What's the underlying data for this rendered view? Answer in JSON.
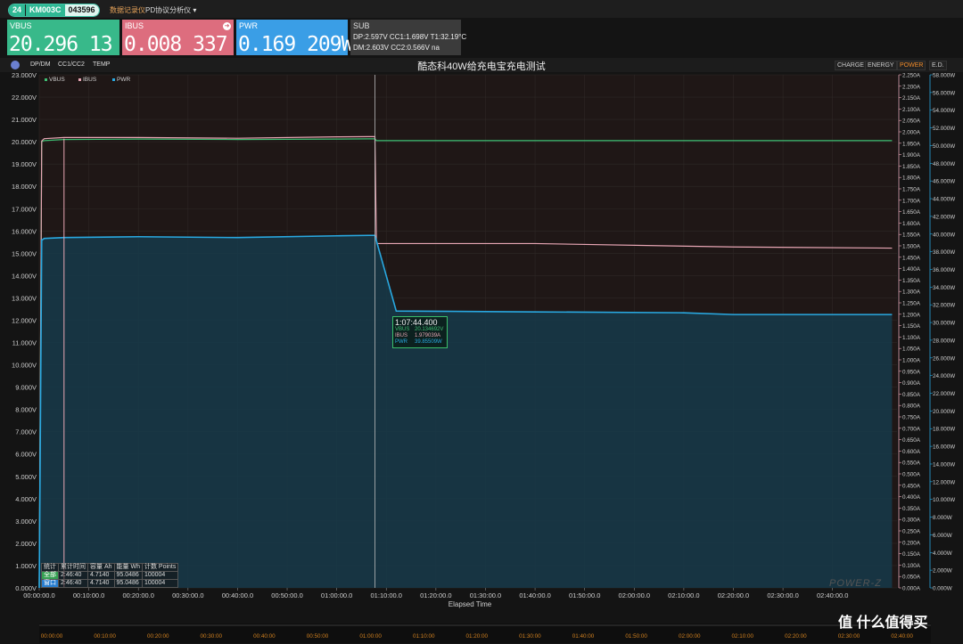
{
  "topbar": {
    "device_num": "24",
    "device_model": "KM003C",
    "device_serial": "043596",
    "menu_record": "数据记录仪",
    "menu_pd": "PD协议分析仪 ▾"
  },
  "meters": {
    "vbus": {
      "label": "VBUS",
      "value": "20.296 13 V"
    },
    "ibus": {
      "label": "IBUS",
      "value": "0.008 337 A"
    },
    "pwr": {
      "label": "PWR",
      "value": "0.169 209W"
    },
    "sub": {
      "label": "SUB",
      "row1": "DP:2.597V   CC1:1.698V   T1:32.19°C",
      "row2": "DM:2.603V   CC2:0.566V  na"
    }
  },
  "chart_header": {
    "tabs": [
      "DP/DM",
      "CC1/CC2",
      "TEMP"
    ],
    "title": "酷态科40W给充电宝充电测试",
    "right_tabs": [
      "CHARGE",
      "ENERGY",
      "POWER",
      "E.D."
    ],
    "active_right_tab": "POWER"
  },
  "tooltip": {
    "time": "1:07:44.400",
    "vbus_label": "VBUS",
    "vbus": "20.134692V",
    "ibus_label": "IBUS",
    "ibus": "1.979039A",
    "pwr_label": "PWR",
    "pwr": "39.85509W"
  },
  "stats": {
    "headers": [
      "统计",
      "累计时间",
      "容量 Ah",
      "能量 Wh",
      "计数 Points"
    ],
    "rows": [
      [
        "全部",
        "2:46:40",
        "4.7140",
        "95.0486",
        "100004"
      ],
      [
        "窗口",
        "2:46:40",
        "4.7140",
        "95.0486",
        "100004"
      ]
    ]
  },
  "watermark": "POWER-Z",
  "site_watermark": "值 什么值得买",
  "colors": {
    "vbus": "#3fbf73",
    "ibus": "#e8a6b4",
    "pwr": "#29a8e0",
    "active_tab": "#f08c2c"
  },
  "chart_data": {
    "type": "line",
    "xlabel": "Elapsed Time",
    "x_ticks": [
      "00:00:00.0",
      "00:10:00.0",
      "00:20:00.0",
      "00:30:00.0",
      "00:40:00.0",
      "00:50:00.0",
      "01:00:00.0",
      "01:10:00.0",
      "01:20:00.0",
      "01:30:00.0",
      "01:40:00.0",
      "01:50:00.0",
      "02:00:00.0",
      "02:10:00.0",
      "02:20:00.0",
      "02:30:00.0",
      "02:40:00.0"
    ],
    "overview_ticks": [
      "00:00:00",
      "00:10:00",
      "00:20:00",
      "00:30:00",
      "00:40:00",
      "00:50:00",
      "01:00:00",
      "01:10:00",
      "01:20:00",
      "01:30:00",
      "01:40:00",
      "01:50:00",
      "02:00:00",
      "02:10:00",
      "02:20:00",
      "02:30:00",
      "02:40:00"
    ],
    "x_range_min": [
      0,
      173
    ],
    "legend": [
      "VBUS",
      "IBUS",
      "PWR"
    ],
    "legend_position": "top-left",
    "y_left": {
      "unit": "V",
      "ylim": [
        0,
        23
      ],
      "ticks": [
        "0.000V",
        "1.000V",
        "2.000V",
        "3.000V",
        "4.000V",
        "5.000V",
        "6.000V",
        "7.000V",
        "8.000V",
        "9.000V",
        "10.000V",
        "11.000V",
        "12.000V",
        "13.000V",
        "14.000V",
        "15.000V",
        "16.000V",
        "17.000V",
        "18.000V",
        "19.000V",
        "20.000V",
        "21.000V",
        "22.000V",
        "23.000V"
      ]
    },
    "y_right_current": {
      "unit": "A",
      "ylim": [
        0,
        2.25
      ],
      "ticks": [
        "0.000A",
        "0.050A",
        "0.100A",
        "0.150A",
        "0.200A",
        "0.250A",
        "0.300A",
        "0.350A",
        "0.400A",
        "0.450A",
        "0.500A",
        "0.550A",
        "0.600A",
        "0.650A",
        "0.700A",
        "0.750A",
        "0.800A",
        "0.850A",
        "0.900A",
        "0.950A",
        "1.000A",
        "1.050A",
        "1.100A",
        "1.150A",
        "1.200A",
        "1.250A",
        "1.300A",
        "1.350A",
        "1.400A",
        "1.450A",
        "1.500A",
        "1.550A",
        "1.600A",
        "1.650A",
        "1.700A",
        "1.750A",
        "1.800A",
        "1.850A",
        "1.900A",
        "1.950A",
        "2.000A",
        "2.050A",
        "2.100A",
        "2.150A",
        "2.200A",
        "2.250A"
      ]
    },
    "y_right_power": {
      "unit": "W",
      "ylim": [
        0,
        58
      ],
      "ticks": [
        "0.000W",
        "2.000W",
        "4.000W",
        "6.000W",
        "8.000W",
        "10.000W",
        "12.000W",
        "14.000W",
        "16.000W",
        "18.000W",
        "20.000W",
        "22.000W",
        "24.000W",
        "26.000W",
        "28.000W",
        "30.000W",
        "32.000W",
        "34.000W",
        "36.000W",
        "38.000W",
        "40.000W",
        "42.000W",
        "44.000W",
        "46.000W",
        "48.000W",
        "50.000W",
        "52.000W",
        "54.000W",
        "56.000W",
        "58.000W"
      ]
    },
    "series": [
      {
        "name": "VBUS",
        "unit": "V",
        "x_min": [
          0,
          0.5,
          1,
          5,
          20,
          40,
          60,
          66.5,
          67.7,
          68,
          100,
          140,
          172
        ],
        "y": [
          0.1,
          20.0,
          20.05,
          20.1,
          20.12,
          20.1,
          20.12,
          20.13,
          20.13,
          20.05,
          20.05,
          20.05,
          20.05
        ]
      },
      {
        "name": "IBUS",
        "unit": "A",
        "x_min": [
          0,
          0.5,
          1,
          5,
          20,
          40,
          60,
          66.5,
          67.7,
          68,
          100,
          140,
          172
        ],
        "y": [
          0.0,
          1.96,
          1.97,
          1.975,
          1.975,
          1.972,
          1.978,
          1.979,
          1.979,
          1.51,
          1.51,
          1.495,
          1.49
        ]
      },
      {
        "name": "PWR",
        "unit": "W",
        "x_min": [
          0,
          0.5,
          1,
          5,
          20,
          40,
          60,
          66.5,
          67.7,
          72,
          100,
          130,
          140,
          172
        ],
        "y": [
          0.0,
          39.3,
          39.5,
          39.6,
          39.7,
          39.6,
          39.8,
          39.85,
          39.85,
          31.3,
          31.2,
          31.1,
          30.9,
          30.9
        ]
      }
    ]
  }
}
